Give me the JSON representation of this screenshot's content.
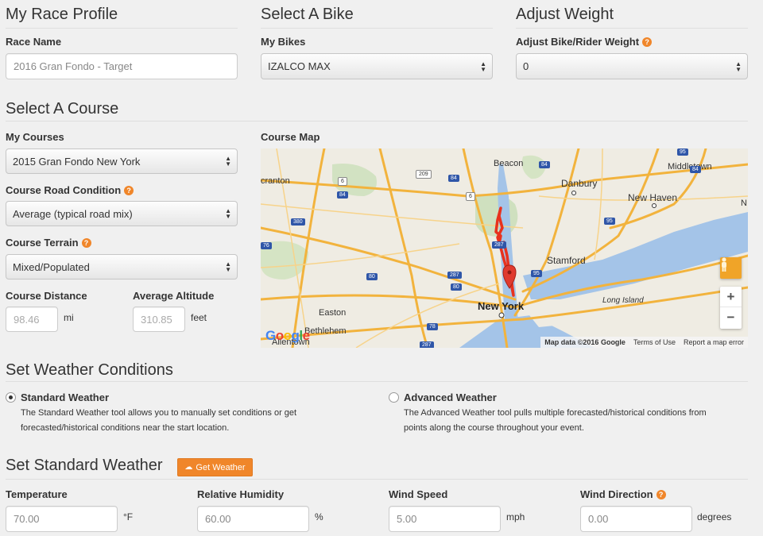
{
  "profile": {
    "heading": "My Race Profile",
    "race_name_label": "Race Name",
    "race_name_value": "2016 Gran Fondo - Target"
  },
  "bike": {
    "heading": "Select A Bike",
    "my_bikes_label": "My Bikes",
    "selected_bike": "IZALCO MAX"
  },
  "weight": {
    "heading": "Adjust Weight",
    "label": "Adjust Bike/Rider Weight",
    "value": "0"
  },
  "course": {
    "heading": "Select A Course",
    "my_courses_label": "My Courses",
    "selected_course": "2015 Gran Fondo New York",
    "road_condition_label": "Course Road Condition",
    "road_condition_value": "Average (typical road mix)",
    "terrain_label": "Course Terrain",
    "terrain_value": "Mixed/Populated",
    "distance_label": "Course Distance",
    "distance_value": "98.46",
    "distance_unit": "mi",
    "altitude_label": "Average Altitude",
    "altitude_value": "310.85",
    "altitude_unit": "feet",
    "map_label": "Course Map"
  },
  "map": {
    "places": [
      "Beacon",
      "Middletown",
      "Danbury",
      "New Haven",
      "Stamford",
      "New York",
      "Easton",
      "Bethlehem",
      "Allentown",
      "Long Island",
      "cranton",
      "N"
    ],
    "routes": [
      "6",
      "209",
      "84",
      "84",
      "6",
      "84",
      "380",
      "287",
      "80",
      "287",
      "80",
      "95",
      "95",
      "95",
      "78",
      "287",
      "76",
      "84"
    ],
    "zoom_in": "+",
    "zoom_out": "−",
    "logo": "Google",
    "attribution": [
      "Map data ©2016 Google",
      "Terms of Use",
      "Report a map error"
    ]
  },
  "weather": {
    "heading": "Set Weather Conditions",
    "standard_title": "Standard Weather",
    "standard_desc_1": "The Standard Weather tool allows you to manually set conditions or get",
    "standard_desc_2": "forecasted/historical conditions near the start location.",
    "advanced_title": "Advanced Weather",
    "advanced_desc_1": "The Advanced Weather tool pulls multiple forecasted/historical conditions from",
    "advanced_desc_2": "points along the course throughout your event.",
    "selected": "standard"
  },
  "standard_weather": {
    "heading": "Set Standard Weather",
    "get_weather_button": "Get Weather",
    "temperature_label": "Temperature",
    "temperature_value": "70.00",
    "temperature_unit": "°F",
    "humidity_label": "Relative Humidity",
    "humidity_value": "60.00",
    "humidity_unit": "%",
    "wind_speed_label": "Wind Speed",
    "wind_speed_value": "5.00",
    "wind_speed_unit": "mph",
    "wind_direction_label": "Wind Direction",
    "wind_direction_value": "0.00",
    "wind_direction_unit": "degrees"
  },
  "colors": {
    "accent": "#f0862a",
    "route": "#e8321e",
    "water": "#a4c4e8",
    "highway": "#f2b33d"
  }
}
